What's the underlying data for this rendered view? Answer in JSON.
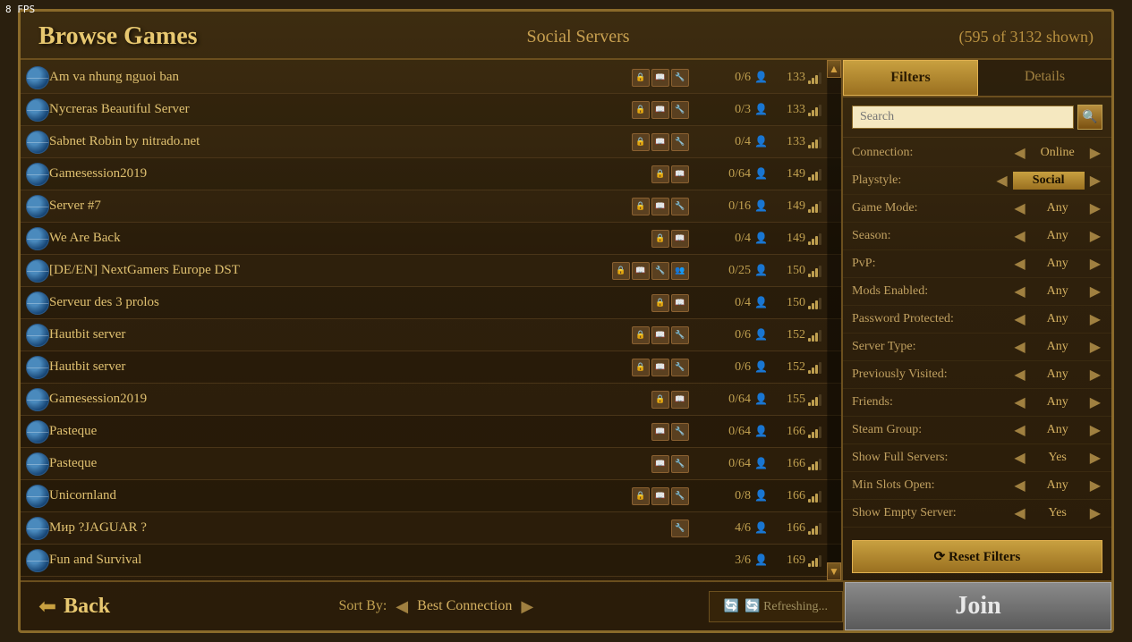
{
  "fps": "8 FPS",
  "header": {
    "title": "Browse Games",
    "subtitle": "Social Servers",
    "count": "(595 of 3132 shown)"
  },
  "tabs": {
    "filters": "Filters",
    "details": "Details",
    "active": "filters"
  },
  "search": {
    "placeholder": "Search",
    "value": ""
  },
  "filters": [
    {
      "label": "Connection:",
      "value": "Online",
      "highlighted": false
    },
    {
      "label": "Playstyle:",
      "value": "Social",
      "highlighted": true
    },
    {
      "label": "Game Mode:",
      "value": "Any",
      "highlighted": false
    },
    {
      "label": "Season:",
      "value": "Any",
      "highlighted": false
    },
    {
      "label": "PvP:",
      "value": "Any",
      "highlighted": false
    },
    {
      "label": "Mods Enabled:",
      "value": "Any",
      "highlighted": false
    },
    {
      "label": "Password Protected:",
      "value": "Any",
      "highlighted": false
    },
    {
      "label": "Server Type:",
      "value": "Any",
      "highlighted": false
    },
    {
      "label": "Previously Visited:",
      "value": "Any",
      "highlighted": false
    },
    {
      "label": "Friends:",
      "value": "Any",
      "highlighted": false
    },
    {
      "label": "Steam Group:",
      "value": "Any",
      "highlighted": false
    },
    {
      "label": "Show Full Servers:",
      "value": "Yes",
      "highlighted": false
    },
    {
      "label": "Min Slots Open:",
      "value": "Any",
      "highlighted": false
    },
    {
      "label": "Show Empty Server:",
      "value": "Yes",
      "highlighted": false
    }
  ],
  "reset_btn": "⟳ Reset Filters",
  "servers": [
    {
      "name": "Am va nhung nguoi ban",
      "icons": [
        "lock",
        "book",
        "wrench"
      ],
      "extra_icon": false,
      "players": "0/6",
      "ping": 133,
      "ping_level": 3
    },
    {
      "name": "Nycreras Beautiful Server",
      "icons": [
        "lock",
        "book",
        "wrench"
      ],
      "extra_icon": false,
      "players": "0/3",
      "ping": 133,
      "ping_level": 3
    },
    {
      "name": "Sabnet Robin by nitrado.net",
      "icons": [
        "lock",
        "book",
        "wrench"
      ],
      "extra_icon": false,
      "players": "0/4",
      "ping": 133,
      "ping_level": 3
    },
    {
      "name": "Gamesession2019",
      "icons": [
        "lock",
        "book"
      ],
      "extra_icon": false,
      "players": "0/64",
      "ping": 149,
      "ping_level": 3
    },
    {
      "name": "Server #7",
      "icons": [
        "lock",
        "book",
        "wrench"
      ],
      "extra_icon": false,
      "players": "0/16",
      "ping": 149,
      "ping_level": 3
    },
    {
      "name": "We Are Back",
      "icons": [
        "lock",
        "book"
      ],
      "extra_icon": false,
      "players": "0/4",
      "ping": 149,
      "ping_level": 3
    },
    {
      "name": "[DE/EN] NextGamers Europe DST",
      "icons": [
        "lock",
        "book",
        "wrench"
      ],
      "extra_icon": true,
      "players": "0/25",
      "ping": 150,
      "ping_level": 3
    },
    {
      "name": "Serveur des 3 prolos",
      "icons": [
        "lock",
        "book"
      ],
      "extra_icon": false,
      "players": "0/4",
      "ping": 150,
      "ping_level": 3
    },
    {
      "name": "Hautbit server",
      "icons": [
        "lock",
        "book",
        "wrench"
      ],
      "extra_icon": false,
      "players": "0/6",
      "ping": 152,
      "ping_level": 3
    },
    {
      "name": "Hautbit server",
      "icons": [
        "lock",
        "book",
        "wrench"
      ],
      "extra_icon": false,
      "players": "0/6",
      "ping": 152,
      "ping_level": 3
    },
    {
      "name": "Gamesession2019",
      "icons": [
        "lock",
        "book"
      ],
      "extra_icon": false,
      "players": "0/64",
      "ping": 155,
      "ping_level": 3
    },
    {
      "name": "Pasteque",
      "icons": [
        "book",
        "wrench"
      ],
      "extra_icon": false,
      "players": "0/64",
      "ping": 166,
      "ping_level": 3
    },
    {
      "name": "Pasteque",
      "icons": [
        "book",
        "wrench"
      ],
      "extra_icon": false,
      "players": "0/64",
      "ping": 166,
      "ping_level": 3
    },
    {
      "name": "Unicornland",
      "icons": [
        "lock",
        "book",
        "wrench"
      ],
      "extra_icon": false,
      "players": "0/8",
      "ping": 166,
      "ping_level": 3
    },
    {
      "name": "Мир ?JAGUAR ?",
      "icons": [
        "wrench"
      ],
      "extra_icon": false,
      "players": "4/6",
      "ping": 166,
      "ping_level": 3
    },
    {
      "name": "Fun and Survival",
      "icons": [],
      "extra_icon": false,
      "players": "3/6",
      "ping": 169,
      "ping_level": 3
    }
  ],
  "footer": {
    "back": "Back",
    "sort_label": "Sort By:",
    "sort_value": "Best Connection",
    "refresh": "🔄 Refreshing...",
    "join": "Join"
  }
}
